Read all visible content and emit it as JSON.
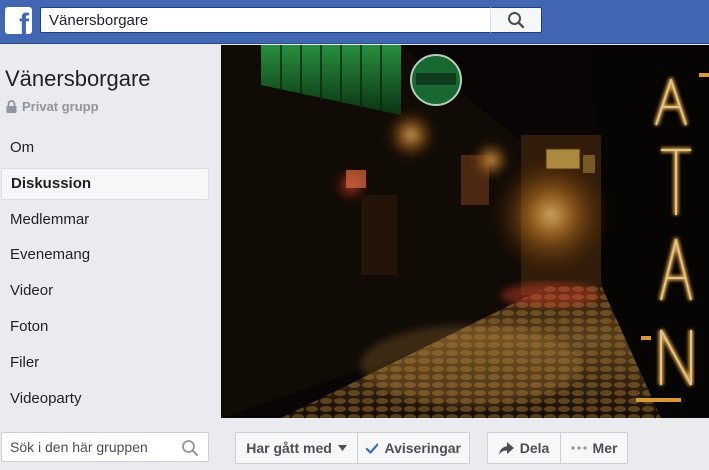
{
  "topbar": {
    "logo_letter": "f",
    "search_value": "Vänersborgare",
    "search_icon": "search-icon",
    "brand_color": "#4267b2"
  },
  "group": {
    "name": "Vänersborgare",
    "privacy": "Privat grupp",
    "privacy_icon": "lock-icon"
  },
  "nav": {
    "items": [
      {
        "label": "Om",
        "active": false
      },
      {
        "label": "Diskussion",
        "active": true
      },
      {
        "label": "Medlemmar",
        "active": false
      },
      {
        "label": "Evenemang",
        "active": false
      },
      {
        "label": "Videor",
        "active": false
      },
      {
        "label": "Foton",
        "active": false
      },
      {
        "label": "Filer",
        "active": false
      },
      {
        "label": "Videoparty",
        "active": false
      }
    ]
  },
  "sidebar_search": {
    "placeholder": "Sök i den här gruppen",
    "icon": "search-icon"
  },
  "actions": {
    "joined_label": "Har gått med",
    "notifications_label": "Aviseringar",
    "share_label": "Dela",
    "more_label": "Mer"
  }
}
